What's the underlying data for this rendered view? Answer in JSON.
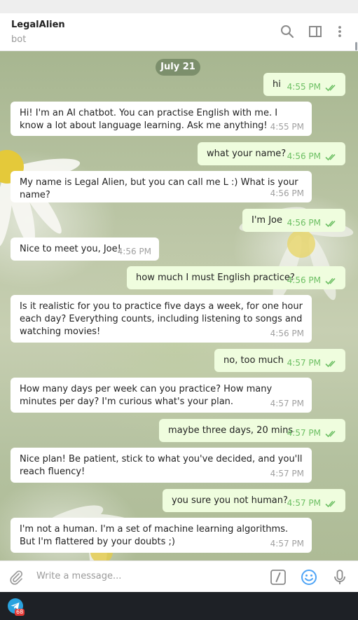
{
  "header": {
    "title": "LegalAlien",
    "subtitle": "bot",
    "icons": [
      "search-icon",
      "sidebar-toggle-icon",
      "more-options-icon"
    ]
  },
  "chat": {
    "date_label": "July 21",
    "messages": [
      {
        "direction": "out",
        "text": "hi",
        "time": "4:55 PM"
      },
      {
        "direction": "in",
        "text": "Hi! I'm an AI chatbot. You can practise English with me. I know a lot about language learning. Ask me anything!",
        "time": "4:55 PM"
      },
      {
        "direction": "out",
        "text": "what your name?",
        "time": "4:56 PM"
      },
      {
        "direction": "in",
        "text": "My name is Legal Alien, but you can call me L :) What is your name?",
        "time": "4:56 PM"
      },
      {
        "direction": "out",
        "text": "I'm Joe",
        "time": "4:56 PM"
      },
      {
        "direction": "in",
        "text": "Nice to meet you, Joe!",
        "time": "4:56 PM"
      },
      {
        "direction": "out",
        "text": "how much I must English practice?",
        "time": "4:56 PM"
      },
      {
        "direction": "in",
        "text": "Is it realistic for you to practice five days a week, for one hour each day? Everything counts, including listening to songs and watching movies!",
        "time": "4:56 PM"
      },
      {
        "direction": "out",
        "text": "no, too much",
        "time": "4:57 PM"
      },
      {
        "direction": "in",
        "text": "How many days per week can you practice? How many minutes per day? I'm curious what's your plan.",
        "time": "4:57 PM"
      },
      {
        "direction": "out",
        "text": "maybe three days, 20 mins",
        "time": "4:57 PM"
      },
      {
        "direction": "in",
        "text": "Nice plan! Be patient, stick to what you've decided, and you'll reach fluency!",
        "time": "4:57 PM"
      },
      {
        "direction": "out",
        "text": "you sure you not human?",
        "time": "4:57 PM"
      },
      {
        "direction": "in",
        "text": "I'm not a human. I'm a set of machine learning algorithms. But I'm flattered by your doubts ;)",
        "time": "4:57 PM"
      }
    ]
  },
  "composer": {
    "placeholder": "Write a message...",
    "icons": [
      "attach-icon",
      "bot-commands-icon",
      "emoji-icon",
      "microphone-icon"
    ]
  },
  "taskbar": {
    "app_icon": "telegram-icon",
    "badge": "68"
  },
  "colors": {
    "incoming_bubble": "#ffffff",
    "outgoing_bubble": "#effdde",
    "outgoing_meta": "#6cbf63",
    "accent": "#4ea4f6"
  }
}
